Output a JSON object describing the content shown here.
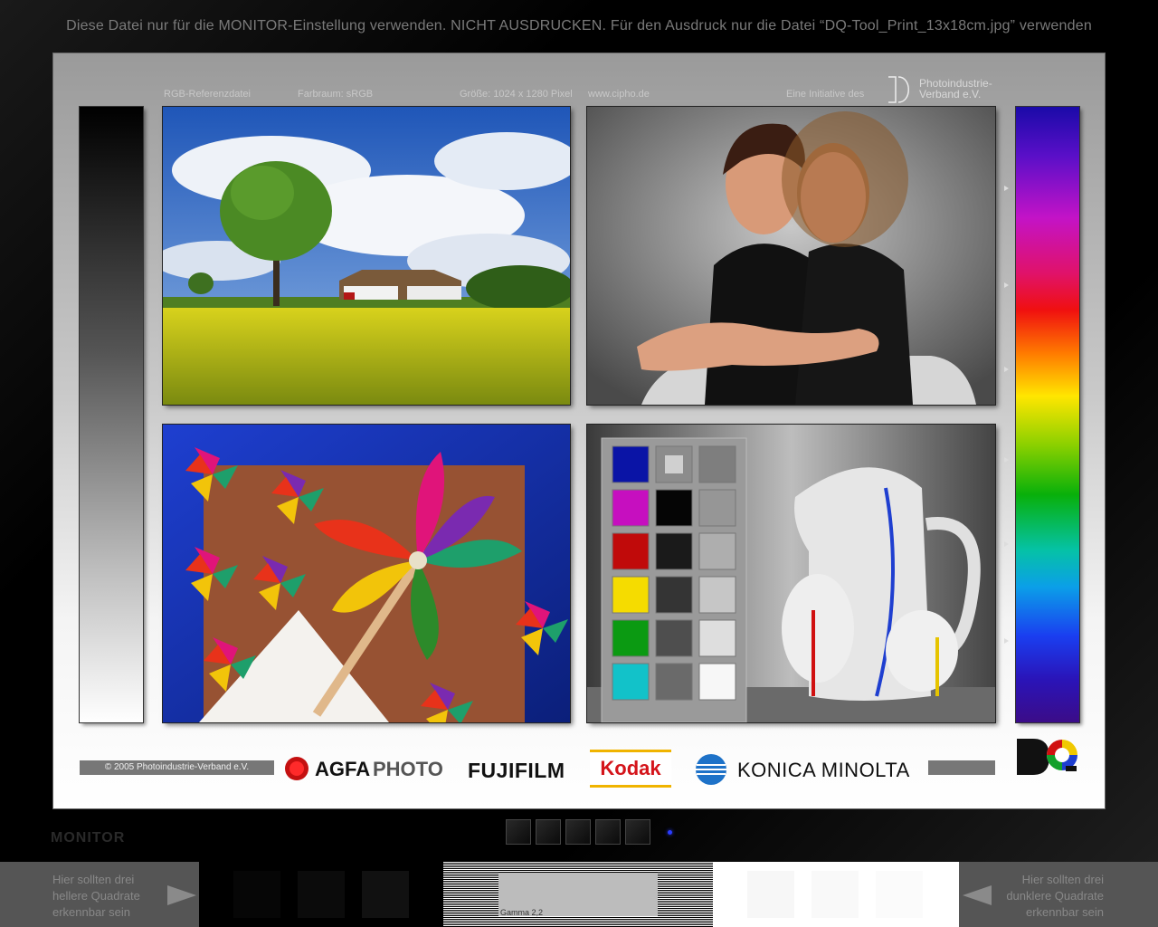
{
  "top_notice": "Diese Datei nur für die MONITOR-Einstellung verwenden. NICHT AUSDRUCKEN.  Für den Ausdruck nur die Datei “DQ-Tool_Print_13x18cm.jpg” verwenden",
  "header": {
    "file_type": "RGB-Referenzdatei",
    "color_space": "Farbraum: sRGB",
    "size": "Größe: 1024 x 1280 Pixel",
    "website": "www.cipho.de",
    "initiative": "Eine Initiative des",
    "org_line1": "Photoindustrie-",
    "org_line2": "Verband e.V."
  },
  "footer": {
    "copyright": "© 2005 Photoindustrie-Verband e.V.",
    "brands": [
      "AGFAPHOTO",
      "FUJIFILM",
      "Kodak",
      "KONICA MINOLTA"
    ],
    "dq_logo": "DQ"
  },
  "monitor": {
    "label": "MONITOR"
  },
  "calibration": {
    "hint_left": "Hier sollten drei hellere Quadrate erkennbar sein",
    "hint_right": "Hier sollten drei dunklere Quadrate erkennbar sein",
    "gamma_label": "Gamma 2,2"
  },
  "colors": {
    "chart_left": [
      "#0a14a6",
      "#c60fbf",
      "#c00a0a",
      "#f5dc00",
      "#0b9a12",
      "#12c2c9"
    ],
    "chart_mid": [
      "#8c8c8c",
      "#050505",
      "#1a1a1a",
      "#343434",
      "#4e4e4e",
      "#6a6a6a"
    ],
    "chart_right": [
      "#7e7e7e",
      "#969696",
      "#aeaeae",
      "#c6c6c6",
      "#dedede",
      "#f7f7f7"
    ]
  }
}
